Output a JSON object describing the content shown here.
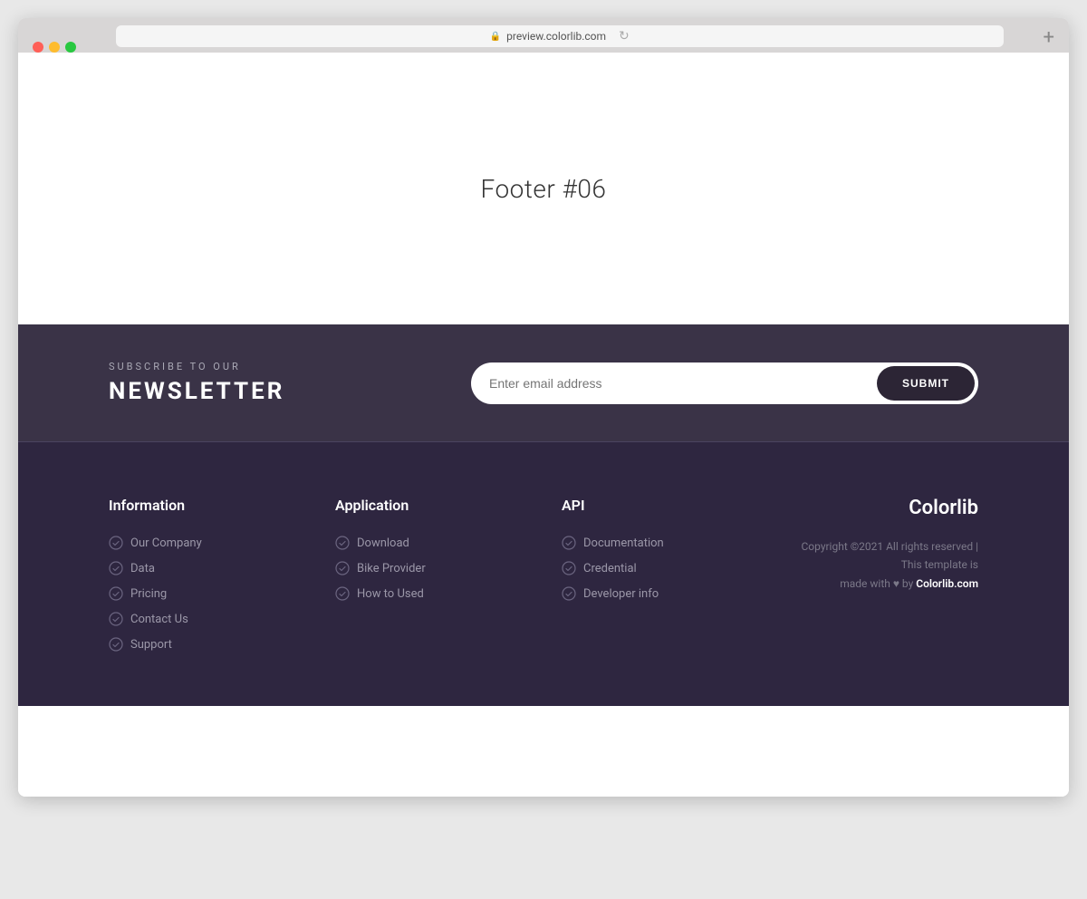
{
  "browser": {
    "url": "preview.colorlib.com",
    "tab_label": "preview.colorlib.com"
  },
  "page": {
    "title": "Footer #06"
  },
  "newsletter": {
    "sub_heading": "SUBSCRIBE TO OUR",
    "main_heading": "NEWSLETTER",
    "input_placeholder": "Enter email address",
    "submit_label": "SUBMIT"
  },
  "footer": {
    "columns": [
      {
        "title": "Information",
        "links": [
          "Our Company",
          "Data",
          "Pricing",
          "Contact Us",
          "Support"
        ]
      },
      {
        "title": "Application",
        "links": [
          "Download",
          "Bike Provider",
          "How to Used"
        ]
      },
      {
        "title": "API",
        "links": [
          "Documentation",
          "Credential",
          "Developer info"
        ]
      }
    ],
    "brand": "Colorlib",
    "copyright_line1": "Copyright ©2021 All rights reserved | This template is",
    "copyright_line2": "made with ♥ by",
    "copyright_brand": "Colorlib.com"
  }
}
